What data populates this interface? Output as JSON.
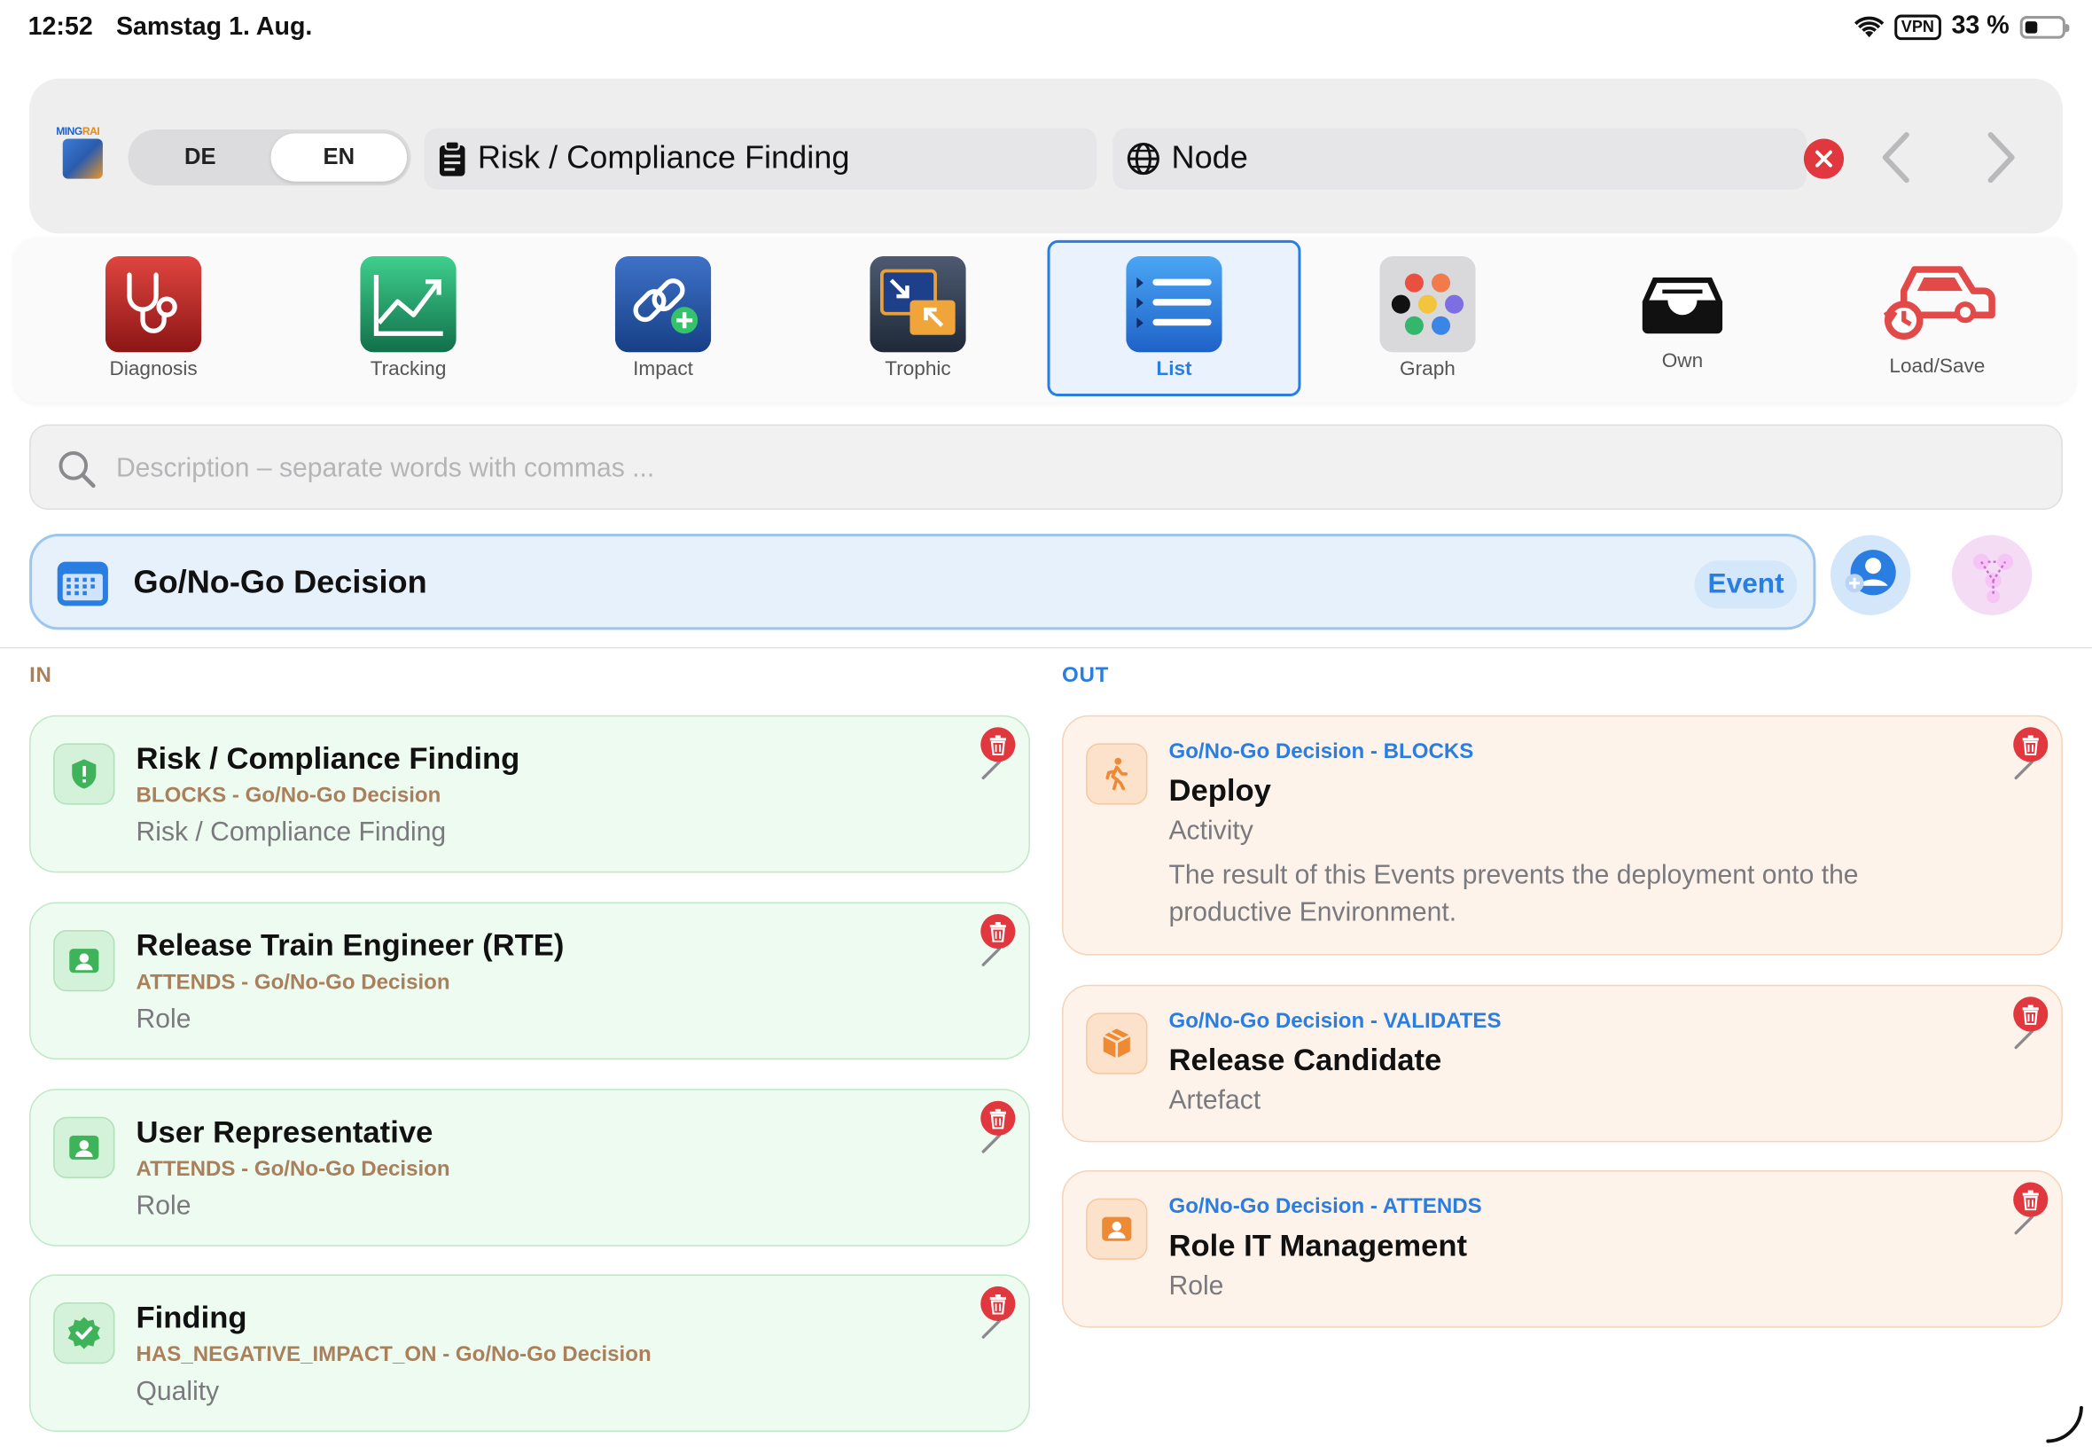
{
  "status": {
    "time": "12:52",
    "date": "Samstag 1. Aug.",
    "vpn": "VPN",
    "battery": "33 %",
    "battery_level": 0.33
  },
  "header": {
    "logo_text_a": "MING",
    "logo_text_b": "RAI",
    "lang_de": "DE",
    "lang_en": "EN",
    "lang_selected": "EN",
    "title_field": "Risk / Compliance Finding",
    "node_field": "Node"
  },
  "toolbar": [
    {
      "key": "diagnosis",
      "label": "Diagnosis",
      "icon": "stethoscope-icon"
    },
    {
      "key": "tracking",
      "label": "Tracking",
      "icon": "line-chart-icon"
    },
    {
      "key": "impact",
      "label": "Impact",
      "icon": "link-plus-icon"
    },
    {
      "key": "trophic",
      "label": "Trophic",
      "icon": "trophic-arrows-icon"
    },
    {
      "key": "list",
      "label": "List",
      "icon": "list-icon",
      "active": true
    },
    {
      "key": "graph",
      "label": "Graph",
      "icon": "graph-dots-icon"
    },
    {
      "key": "own",
      "label": "Own",
      "icon": "inbox-tray-icon"
    },
    {
      "key": "loadsave",
      "label": "Load/Save",
      "icon": "car-history-icon"
    }
  ],
  "search": {
    "placeholder": "Description – separate words with commas ...",
    "value": ""
  },
  "selected": {
    "title": "Go/No-Go Decision",
    "badge": "Event"
  },
  "columns": {
    "in": "IN",
    "out": "OUT"
  },
  "in_items": [
    {
      "name": "Risk / Compliance Finding",
      "relation": "BLOCKS - Go/No-Go Decision",
      "type": "Risk / Compliance Finding",
      "icon": "shield-alert-icon"
    },
    {
      "name": "Release Train Engineer (RTE)",
      "relation": "ATTENDS - Go/No-Go Decision",
      "type": "Role",
      "icon": "person-card-icon"
    },
    {
      "name": "User Representative",
      "relation": "ATTENDS - Go/No-Go Decision",
      "type": "Role",
      "icon": "person-card-icon"
    },
    {
      "name": "Finding",
      "relation": "HAS_NEGATIVE_IMPACT_ON - Go/No-Go Decision",
      "type": "Quality",
      "icon": "checkmark-seal-icon"
    }
  ],
  "out_items": [
    {
      "name": "Deploy",
      "relation": "Go/No-Go Decision - BLOCKS",
      "type": "Activity",
      "description": "The result of this Events prevents the deployment onto the productive Environment.",
      "icon": "walking-figure-icon"
    },
    {
      "name": "Release Candidate",
      "relation": "Go/No-Go Decision - VALIDATES",
      "type": "Artefact",
      "icon": "box-icon"
    },
    {
      "name": "Role IT Management",
      "relation": "Go/No-Go Decision - ATTENDS",
      "type": "Role",
      "icon": "person-card-icon"
    }
  ],
  "colors": {
    "accent": "#2a7de1",
    "in_card": "#eefbf0",
    "out_card": "#fef3ea",
    "delete": "#e0383e",
    "relation_in": "#a9805b"
  }
}
